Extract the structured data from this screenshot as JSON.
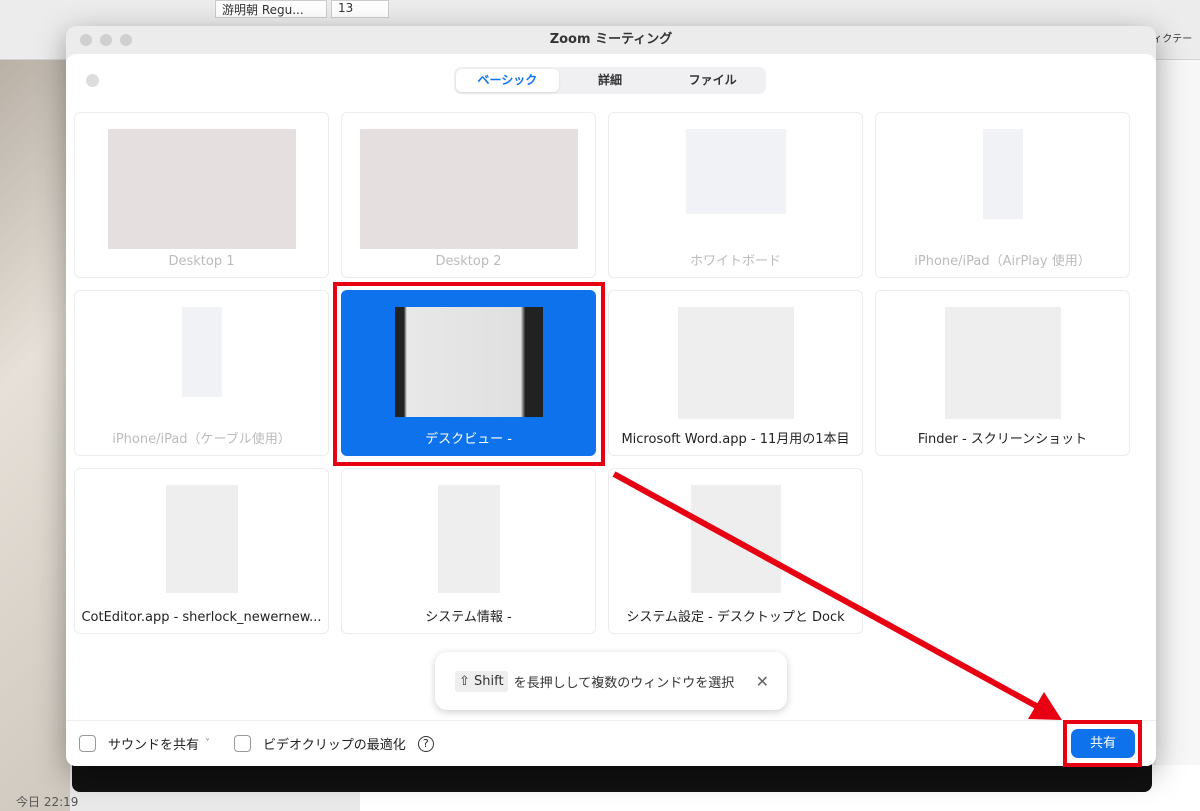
{
  "background": {
    "font": "游明朝 Regu...",
    "size": "13",
    "dictation": "ディクテー",
    "clock": "今日 22:19"
  },
  "window": {
    "title": "Zoom ミーティング"
  },
  "tabs": [
    {
      "label": "ベーシック",
      "active": true
    },
    {
      "label": "詳細"
    },
    {
      "label": "ファイル"
    }
  ],
  "cards": [
    {
      "label": "Desktop 1",
      "disabled": true
    },
    {
      "label": "Desktop 2",
      "disabled": true
    },
    {
      "label": "ホワイトボード",
      "disabled": true
    },
    {
      "label": "iPhone/iPad（AirPlay 使用）",
      "disabled": true
    },
    {
      "label": "iPhone/iPad（ケーブル使用）",
      "disabled": true
    },
    {
      "label": "デスクビュー -",
      "selected": true
    },
    {
      "label": "Microsoft Word.app - 11月用の1本目"
    },
    {
      "label": "Finder - スクリーンショット"
    },
    {
      "label": "CotEditor.app - sherlock_newernew..."
    },
    {
      "label": "システム情報 -"
    },
    {
      "label": "システム設定 - デスクトップと Dock"
    }
  ],
  "toast": {
    "key": "⇧ Shift",
    "text": "を長押しして複数のウィンドウを選択",
    "close": "✕"
  },
  "footer": {
    "sound": "サウンドを共有",
    "sound_chevron": "˅",
    "video": "ビデオクリップの最適化",
    "help": "?"
  },
  "share_label": "共有",
  "colors": {
    "accent": "#0e72ed",
    "annotation": "#e60012"
  }
}
